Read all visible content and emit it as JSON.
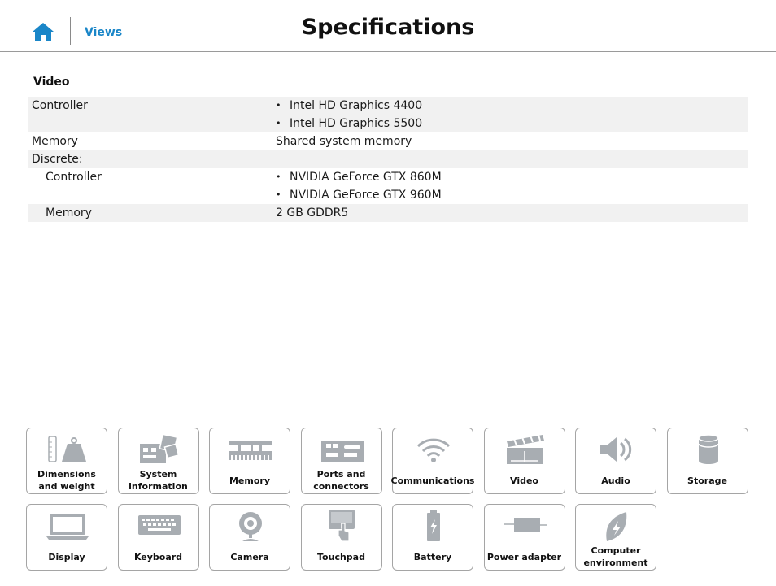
{
  "header": {
    "nav_link": "Views",
    "title": "Specifications"
  },
  "section": {
    "title": "Video"
  },
  "table": {
    "controller_label": "Controller",
    "controller_values": [
      "Intel HD Graphics 4400",
      "Intel HD Graphics 5500"
    ],
    "memory_label": "Memory",
    "memory_value": "Shared system memory",
    "discrete_label": "Discrete:",
    "discrete_controller_label": "Controller",
    "discrete_controller_values": [
      "NVIDIA GeForce GTX 860M",
      "NVIDIA GeForce GTX 960M"
    ],
    "discrete_memory_label": "Memory",
    "discrete_memory_value": "2 GB GDDR5"
  },
  "tiles": [
    {
      "label": "Dimensions and weight",
      "icon": "weight-icon"
    },
    {
      "label": "System information",
      "icon": "motherboard-icon"
    },
    {
      "label": "Memory",
      "icon": "memory-module-icon"
    },
    {
      "label": "Ports and connectors",
      "icon": "ports-icon"
    },
    {
      "label": "Communications",
      "icon": "wifi-icon"
    },
    {
      "label": "Video",
      "icon": "clapperboard-icon"
    },
    {
      "label": "Audio",
      "icon": "speaker-icon"
    },
    {
      "label": "Storage",
      "icon": "storage-drive-icon"
    },
    {
      "label": "Display",
      "icon": "laptop-display-icon"
    },
    {
      "label": "Keyboard",
      "icon": "keyboard-icon"
    },
    {
      "label": "Camera",
      "icon": "webcam-icon"
    },
    {
      "label": "Touchpad",
      "icon": "touchpad-icon"
    },
    {
      "label": "Battery",
      "icon": "battery-icon"
    },
    {
      "label": "Power adapter",
      "icon": "power-adapter-icon"
    },
    {
      "label": "Computer environment",
      "icon": "leaf-icon"
    }
  ],
  "colors": {
    "accent": "#1a86c8",
    "icon_gray": "#a8adb2",
    "row_shade": "#f1f1f1"
  }
}
